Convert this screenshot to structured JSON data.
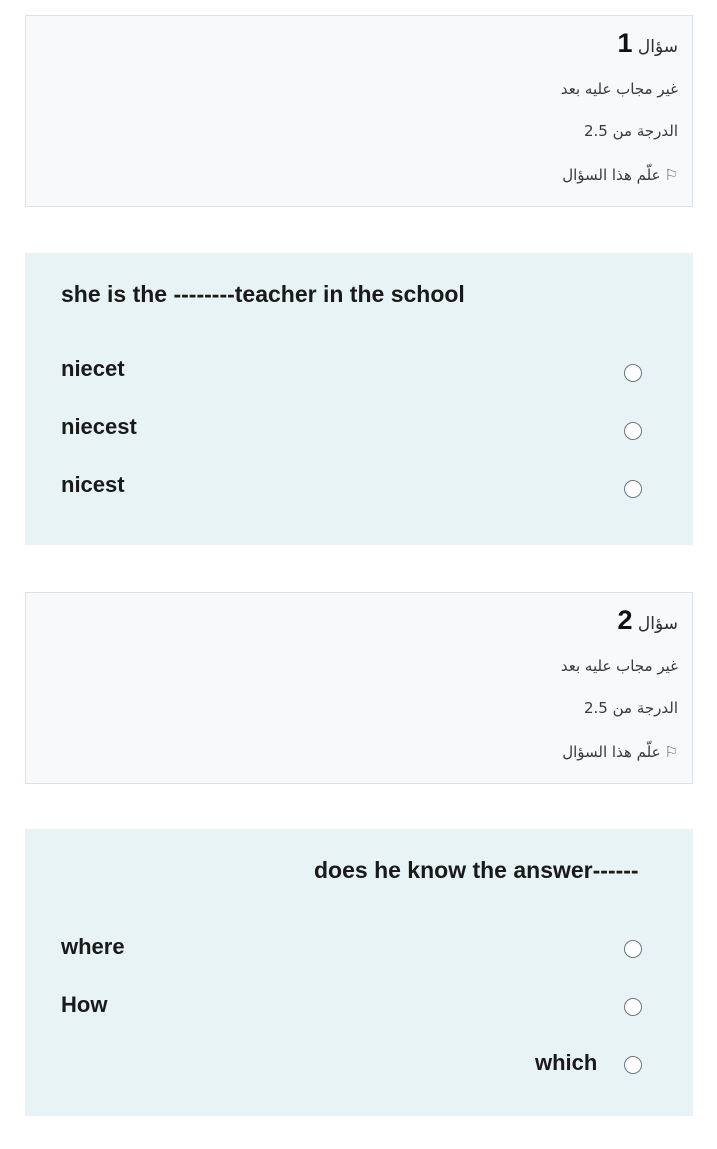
{
  "q1": {
    "word": "سؤال",
    "number": "1",
    "status": "غير مجاب عليه بعد",
    "grade": "الدرجة من 2.5",
    "flag_label": "علّم هذا السؤال",
    "text": "she is the --------teacher in the school",
    "options": [
      "niecet",
      "niecest",
      "nicest"
    ]
  },
  "q2": {
    "word": "سؤال",
    "number": "2",
    "status": "غير مجاب عليه بعد",
    "grade": "الدرجة من 2.5",
    "flag_label": "علّم هذا السؤال",
    "text": "does he know the answer------",
    "options": [
      "where",
      "How",
      "which"
    ]
  }
}
